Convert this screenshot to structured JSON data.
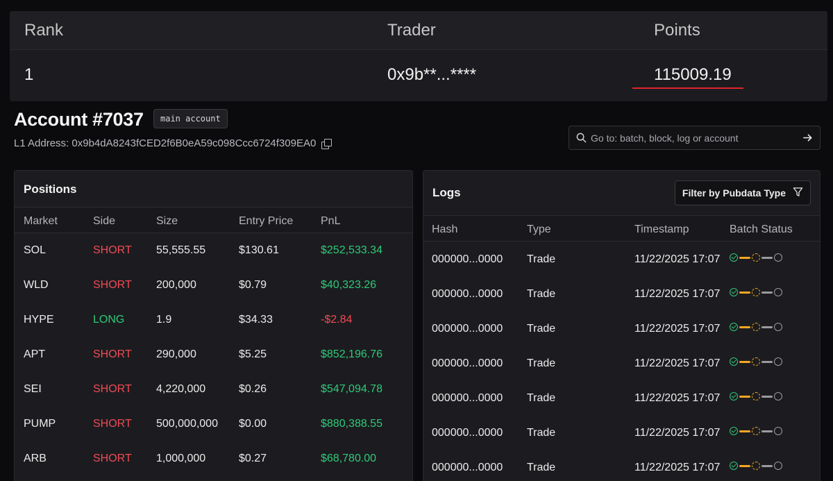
{
  "leaderboard": {
    "columns": {
      "rank": "Rank",
      "trader": "Trader",
      "points": "Points"
    },
    "row": {
      "rank": "1",
      "trader": "0x9b**...****",
      "points": "115009.19"
    }
  },
  "account": {
    "title": "Account #7037",
    "badge": "main account",
    "l1_address": "L1 Address: 0x9b4dA8243fCED2f6B0eA59c098Ccc6724f309EA0"
  },
  "search": {
    "placeholder": "Go to: batch, block, log or account"
  },
  "positions": {
    "title": "Positions",
    "columns": [
      "Market",
      "Side",
      "Size",
      "Entry Price",
      "PnL"
    ],
    "rows": [
      {
        "market": "SOL",
        "side": "SHORT",
        "size": "55,555.55",
        "entry": "$130.61",
        "pnl": "$252,533.34"
      },
      {
        "market": "WLD",
        "side": "SHORT",
        "size": "200,000",
        "entry": "$0.79",
        "pnl": "$40,323.26"
      },
      {
        "market": "HYPE",
        "side": "LONG",
        "size": "1.9",
        "entry": "$34.33",
        "pnl": "-$2.84"
      },
      {
        "market": "APT",
        "side": "SHORT",
        "size": "290,000",
        "entry": "$5.25",
        "pnl": "$852,196.76"
      },
      {
        "market": "SEI",
        "side": "SHORT",
        "size": "4,220,000",
        "entry": "$0.26",
        "pnl": "$547,094.78"
      },
      {
        "market": "PUMP",
        "side": "SHORT",
        "size": "500,000,000",
        "entry": "$0.00",
        "pnl": "$880,388.55"
      },
      {
        "market": "ARB",
        "side": "SHORT",
        "size": "1,000,000",
        "entry": "$0.27",
        "pnl": "$68,780.00"
      }
    ]
  },
  "logs": {
    "title": "Logs",
    "filter_label": "Filter by Pubdata Type",
    "columns": [
      "Hash",
      "Type",
      "Timestamp",
      "Batch Status"
    ],
    "rows": [
      {
        "hash": "000000...0000",
        "type": "Trade",
        "timestamp": "11/22/2025 17:07"
      },
      {
        "hash": "000000...0000",
        "type": "Trade",
        "timestamp": "11/22/2025 17:07"
      },
      {
        "hash": "000000...0000",
        "type": "Trade",
        "timestamp": "11/22/2025 17:07"
      },
      {
        "hash": "000000...0000",
        "type": "Trade",
        "timestamp": "11/22/2025 17:07"
      },
      {
        "hash": "000000...0000",
        "type": "Trade",
        "timestamp": "11/22/2025 17:07"
      },
      {
        "hash": "000000...0000",
        "type": "Trade",
        "timestamp": "11/22/2025 17:07"
      },
      {
        "hash": "000000...0000",
        "type": "Trade",
        "timestamp": "11/22/2025 17:07"
      }
    ]
  },
  "colors": {
    "short": "#f04a55",
    "long": "#2fca78",
    "profit": "#2fca78",
    "loss": "#f04a55",
    "status_done": "#2fca78",
    "status_pending": "#f5a623",
    "status_idle": "#9a9aa0",
    "highlight_underline": "#e0242a"
  },
  "icons": [
    "search-icon",
    "arrow-right-icon",
    "filter-icon",
    "copy-icon"
  ]
}
